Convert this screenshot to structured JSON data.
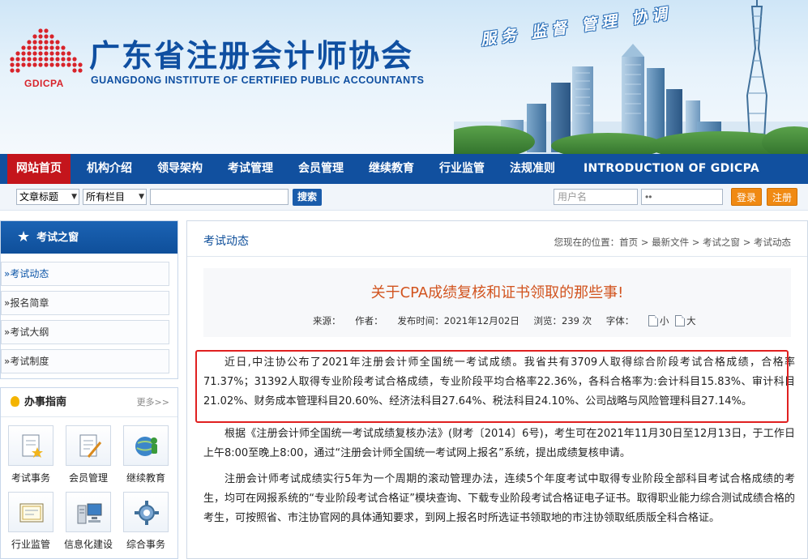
{
  "header": {
    "org_name_cn": "广东省注册会计师协会",
    "org_name_en": "GUANGDONG INSTITUTE OF CERTIFIED PUBLIC ACCOUNTANTS",
    "logo_text": "GDICPA",
    "slogan": "服务 监督 管理 协调"
  },
  "nav": {
    "items": [
      "网站首页",
      "机构介绍",
      "领导架构",
      "考试管理",
      "会员管理",
      "继续教育",
      "行业监管",
      "法规准则",
      "INTRODUCTION OF GDICPA"
    ],
    "active_index": 0
  },
  "search": {
    "scope_select": "文章标题",
    "column_select": "所有栏目",
    "keyword_value": "",
    "search_button": "搜索",
    "username_placeholder": "用户名",
    "password_value": "••",
    "login_button": "登录",
    "register_button": "注册"
  },
  "sidebar": {
    "section_title": "考试之窗",
    "links": [
      "考试动态",
      "报名简章",
      "考试大纲",
      "考试制度"
    ],
    "active_link_index": 0,
    "guide_title": "办事指南",
    "guide_more": "更多>>",
    "guide_tiles": [
      "考试事务",
      "会员管理",
      "继续教育",
      "行业监管",
      "信息化建设",
      "综合事务"
    ]
  },
  "main": {
    "section_title": "考试动态",
    "breadcrumb": "您现在的位置：首页 > 最新文件 > 考试之窗 > 考试动态",
    "article": {
      "title": "关于CPA成绩复核和证书领取的那些事!",
      "source_label": "来源：",
      "author_label": "作者：",
      "publish_label": "发布时间：2021年12月02日",
      "views_label": "浏览：239 次",
      "font_label": "字体：",
      "font_small": "小",
      "font_large": "大",
      "paragraphs": [
        "近日,中注协公布了2021年注册会计师全国统一考试成绩。我省共有3709人取得综合阶段考试合格成绩，合格率71.37%；31392人取得专业阶段考试合格成绩，专业阶段平均合格率22.36%，各科合格率为:会计科目15.83%、审计科目21.02%、财务成本管理科目20.60%、经济法科目27.64%、税法科目24.10%、公司战略与风险管理科目27.14%。",
        "根据《注册会计师全国统一考试成绩复核办法》(财考〔2014〕6号)，考生可在2021年11月30日至12月13日，于工作日上午8:00至晚上8:00，通过“注册会计师全国统一考试网上报名”系统，提出成绩复核申请。",
        "注册会计师考试成绩实行5年为一个周期的滚动管理办法，连续5个年度考试中取得专业阶段全部科目考试合格成绩的考生，均可在网报系统的“专业阶段考试合格证”模块查询、下载专业阶段考试合格证电子证书。取得职业能力综合测试成绩合格的考生，可按照省、市注协官网的具体通知要求，到网上报名时所选证书领取地的市注协领取纸质版全科合格证。"
      ]
    }
  },
  "colors": {
    "brand_blue": "#11509f",
    "active_red": "#c4151c",
    "title_orange": "#d2541f",
    "button_orange": "#f08a13",
    "highlight_red": "#e02020"
  }
}
